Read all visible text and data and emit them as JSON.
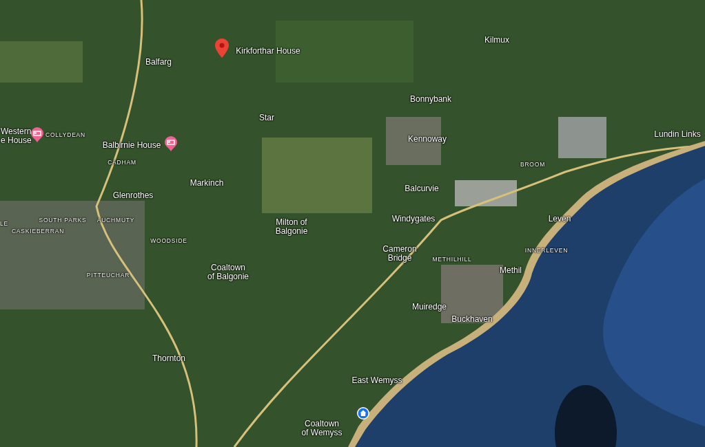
{
  "map": {
    "labels": [
      {
        "text": "Kirkforthar House",
        "kind": "poi"
      },
      {
        "text": "Kilmux",
        "kind": "place"
      },
      {
        "text": "Balfarg",
        "kind": "place"
      },
      {
        "text": "Bonnybank",
        "kind": "place"
      },
      {
        "text": "Star",
        "kind": "place"
      },
      {
        "text": "Western\ne House",
        "kind": "poi"
      },
      {
        "text": "COLLYDEAN",
        "kind": "district"
      },
      {
        "text": "Balbirnie House",
        "kind": "poi"
      },
      {
        "text": "Kennoway",
        "kind": "place"
      },
      {
        "text": "Lundin Links",
        "kind": "place"
      },
      {
        "text": "CADHAM",
        "kind": "district"
      },
      {
        "text": "BROOM",
        "kind": "district"
      },
      {
        "text": "Markinch",
        "kind": "place"
      },
      {
        "text": "Glenrothes",
        "kind": "place"
      },
      {
        "text": "Balcurvie",
        "kind": "place"
      },
      {
        "text": "LE",
        "kind": "district"
      },
      {
        "text": "SOUTH PARKS",
        "kind": "district"
      },
      {
        "text": "AUCHMUTY",
        "kind": "district"
      },
      {
        "text": "CASKIEBERRAN",
        "kind": "district"
      },
      {
        "text": "Milton of\nBalgonie",
        "kind": "place"
      },
      {
        "text": "Windygates",
        "kind": "place"
      },
      {
        "text": "Leven",
        "kind": "place"
      },
      {
        "text": "WOODSIDE",
        "kind": "district"
      },
      {
        "text": "INNERLEVEN",
        "kind": "district"
      },
      {
        "text": "Cameron\nBridge",
        "kind": "place"
      },
      {
        "text": "METHILHILL",
        "kind": "district"
      },
      {
        "text": "Coaltown\nof Balgonie",
        "kind": "place"
      },
      {
        "text": "Methil",
        "kind": "place"
      },
      {
        "text": "PITTEUCHAR",
        "kind": "district"
      },
      {
        "text": "Muiredge",
        "kind": "place"
      },
      {
        "text": "Buckhaven",
        "kind": "place"
      },
      {
        "text": "Thornton",
        "kind": "place"
      },
      {
        "text": "East Wemyss",
        "kind": "place"
      },
      {
        "text": "Coaltown\nof Wemyss",
        "kind": "place"
      }
    ],
    "markers": [
      {
        "kind": "pin"
      },
      {
        "kind": "hotel"
      },
      {
        "kind": "hotel"
      },
      {
        "kind": "home"
      }
    ]
  }
}
